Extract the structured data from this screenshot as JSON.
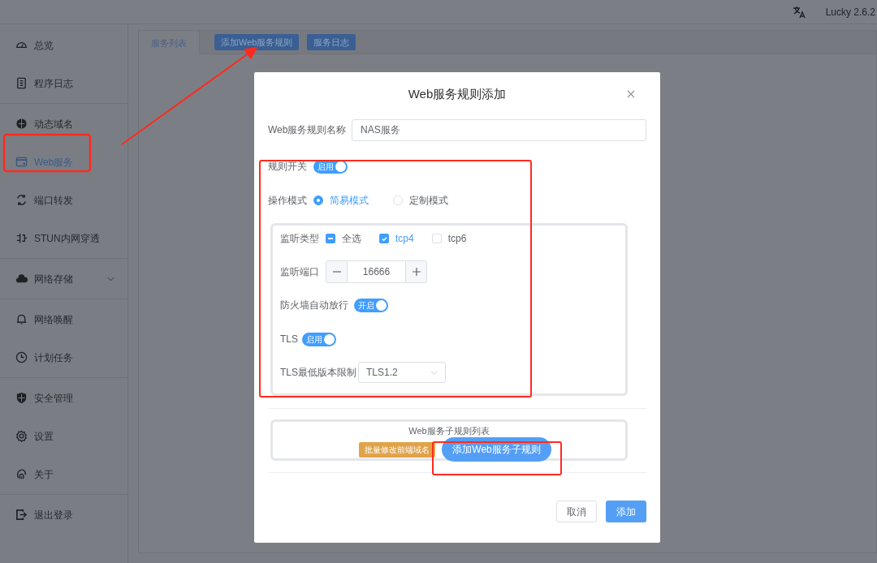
{
  "header": {
    "version": "Lucky 2.6.2"
  },
  "sidebar": {
    "groups": [
      {
        "items": [
          {
            "label": "总览",
            "selected": false,
            "kind": "link"
          },
          {
            "label": "程序日志",
            "selected": false,
            "kind": "link"
          }
        ]
      },
      {
        "items": [
          {
            "label": "动态域名",
            "selected": false,
            "kind": "link"
          },
          {
            "label": "Web服务",
            "selected": true,
            "kind": "link"
          },
          {
            "label": "端口转发",
            "selected": false,
            "kind": "link"
          },
          {
            "label": "STUN内网穿透",
            "selected": false,
            "kind": "link"
          }
        ]
      },
      {
        "items": [
          {
            "label": "网络存储",
            "selected": false,
            "kind": "submenu"
          }
        ]
      },
      {
        "items": [
          {
            "label": "网络唤醒",
            "selected": false,
            "kind": "link"
          },
          {
            "label": "计划任务",
            "selected": false,
            "kind": "link"
          }
        ]
      },
      {
        "items": [
          {
            "label": "安全管理",
            "selected": false,
            "kind": "link"
          },
          {
            "label": "设置",
            "selected": false,
            "kind": "link"
          },
          {
            "label": "关于",
            "selected": false,
            "kind": "link"
          }
        ]
      },
      {
        "items": [
          {
            "label": "退出登录",
            "selected": false,
            "kind": "link"
          }
        ]
      }
    ]
  },
  "tabs": [
    {
      "label": "服务列表",
      "selected": true
    }
  ],
  "toolbar": {
    "buttons": [
      "添加Web服务规则",
      "服务日志"
    ]
  },
  "dialog": {
    "title": "Web服务规则添加",
    "name_field": {
      "label": "Web服务规则名称",
      "value": "NAS服务"
    },
    "rule_switch": {
      "label": "规则开关",
      "on": true,
      "text": "启用"
    },
    "mode": {
      "label": "操作模式",
      "options": [
        {
          "label": "简易模式",
          "selected": true
        },
        {
          "label": "定制模式",
          "selected": false
        }
      ]
    },
    "listen_type": {
      "label": "监听类型",
      "options": [
        {
          "label": "全选",
          "checked": false,
          "indeterminate": true
        },
        {
          "label": "tcp4",
          "checked": true,
          "indeterminate": false
        },
        {
          "label": "tcp6",
          "checked": false,
          "indeterminate": false
        }
      ]
    },
    "listen_port": {
      "label": "监听端口",
      "value": "16666"
    },
    "firewall": {
      "label": "防火墙自动放行",
      "on": true,
      "text": "开启"
    },
    "tls": {
      "label": "TLS",
      "on": true,
      "text": "启用"
    },
    "tls_min": {
      "label": "TLS最低版本限制",
      "value": "TLS1.2"
    },
    "subrules": {
      "title": "Web服务子规则列表",
      "buttons": [
        {
          "label": "批量修改前端域名",
          "kind": "warning"
        },
        {
          "label": "添加Web服务子规则",
          "kind": "primary"
        }
      ]
    },
    "footer_buttons": [
      {
        "label": "取消",
        "kind": "default"
      },
      {
        "label": "添加",
        "kind": "primary"
      }
    ]
  }
}
